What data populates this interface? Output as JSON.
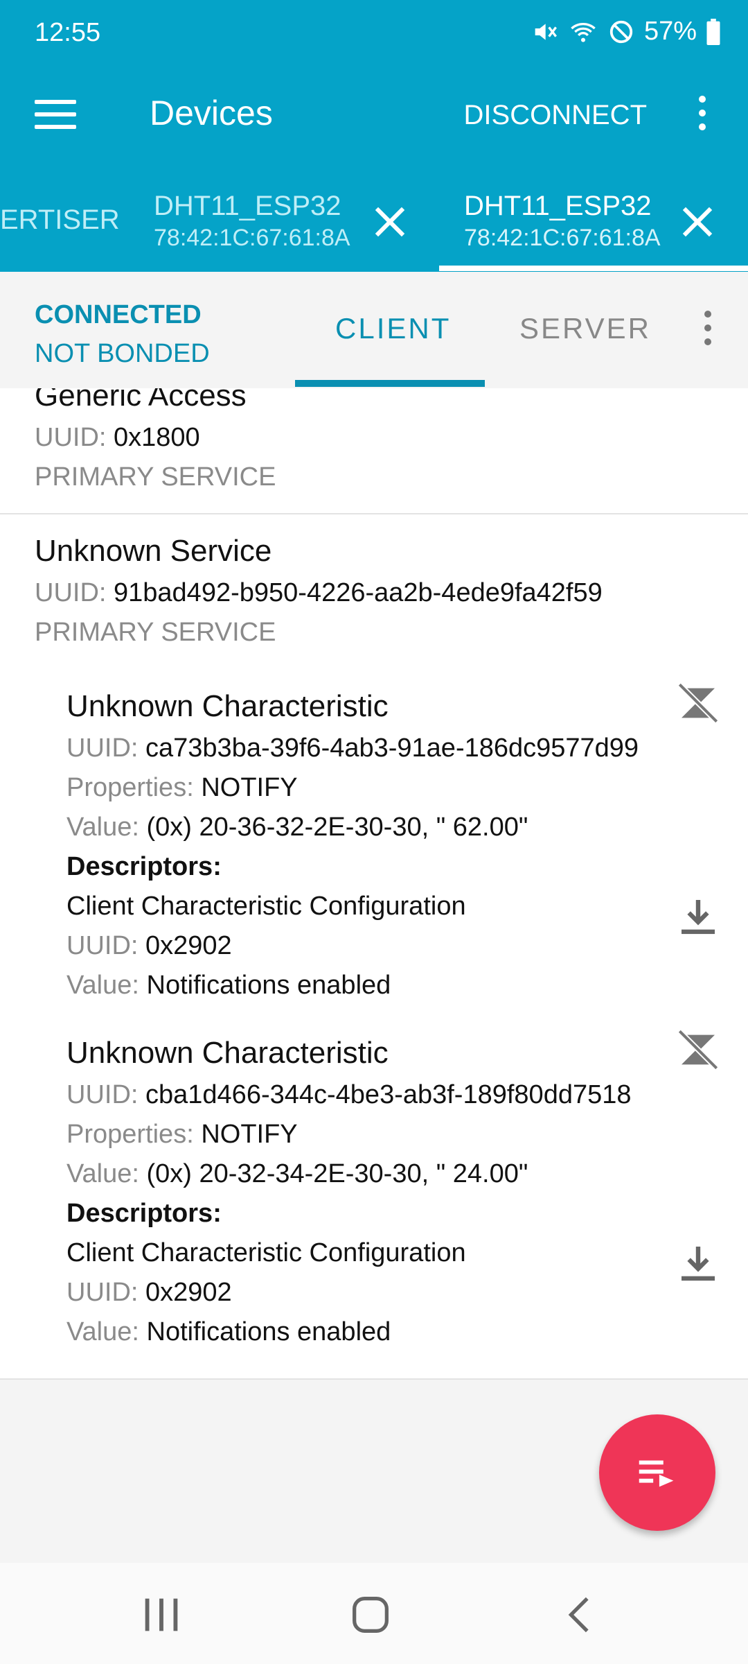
{
  "status": {
    "time": "12:55",
    "battery": "57%"
  },
  "toolbar": {
    "title": "Devices",
    "disconnect": "DISCONNECT"
  },
  "tabs": [
    {
      "label": "ERTISER"
    },
    {
      "name": "DHT11_ESP32",
      "mac": "78:42:1C:67:61:8A"
    },
    {
      "name": "DHT11_ESP32",
      "mac": "78:42:1C:67:61:8A"
    }
  ],
  "connection": {
    "state": "CONNECTED",
    "bond": "NOT BONDED"
  },
  "subtabs": {
    "client": "CLIENT",
    "server": "SERVER"
  },
  "labels": {
    "uuid": "UUID:",
    "properties": "Properties:",
    "value": "Value:",
    "descriptors": "Descriptors:"
  },
  "services": [
    {
      "name": "Generic Access",
      "uuid": "0x1800",
      "type": "PRIMARY SERVICE"
    },
    {
      "name": "Unknown Service",
      "uuid": "91bad492-b950-4226-aa2b-4ede9fa42f59",
      "type": "PRIMARY SERVICE",
      "characteristics": [
        {
          "name": "Unknown Characteristic",
          "uuid": "ca73b3ba-39f6-4ab3-91ae-186dc9577d99",
          "properties": "NOTIFY",
          "value": "(0x) 20-36-32-2E-30-30, \" 62.00\"",
          "descriptor": {
            "name": "Client Characteristic Configuration",
            "uuid": "0x2902",
            "value": "Notifications enabled"
          }
        },
        {
          "name": "Unknown Characteristic",
          "uuid": "cba1d466-344c-4be3-ab3f-189f80dd7518",
          "properties": "NOTIFY",
          "value": "(0x) 20-32-34-2E-30-30, \" 24.00\"",
          "descriptor": {
            "name": "Client Characteristic Configuration",
            "uuid": "0x2902",
            "value": "Notifications enabled"
          }
        }
      ]
    }
  ],
  "colors": {
    "appbar": "#05a3c8",
    "accent": "#0a8fb1",
    "fab": "#ef3557"
  }
}
